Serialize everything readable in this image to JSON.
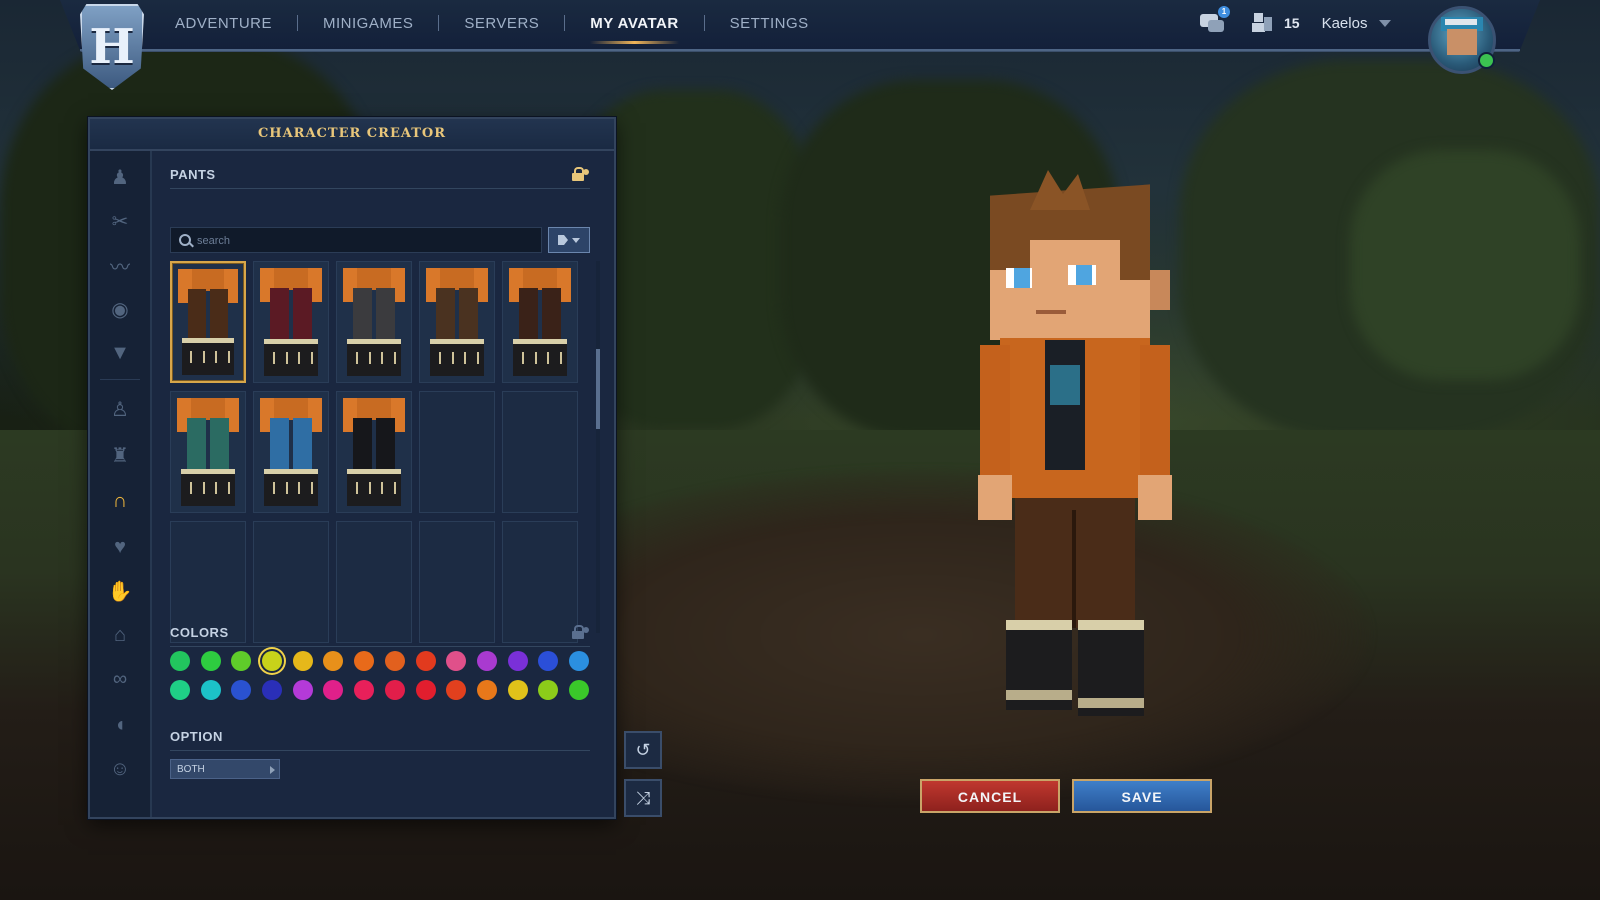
{
  "nav": {
    "items": [
      {
        "label": "ADVENTURE",
        "active": false
      },
      {
        "label": "MINIGAMES",
        "active": false
      },
      {
        "label": "SERVERS",
        "active": false
      },
      {
        "label": "MY AVATAR",
        "active": true
      },
      {
        "label": "SETTINGS",
        "active": false
      }
    ],
    "logo_letter": "H",
    "chat_badge": "1",
    "friends_count": "15",
    "username": "Kaelos"
  },
  "panel": {
    "title": "CHARACTER CREATOR",
    "sidebar_icons": [
      "body-icon",
      "scissors-icon",
      "eyebrows-icon",
      "eye-icon",
      "beard-icon",
      "undershirt-icon",
      "overtop-icon",
      "pants-icon",
      "shoes-icon",
      "gloves-icon",
      "hat-icon",
      "glasses-icon",
      "ear-icon",
      "face-icon"
    ],
    "active_category": "pants-icon",
    "pants": {
      "title": "PANTS",
      "search_placeholder": "search",
      "items": [
        {
          "name": "brown-pants",
          "leg_color": "#4a2c18",
          "selected": true
        },
        {
          "name": "maroon-pants",
          "leg_color": "#5b1a24",
          "selected": false
        },
        {
          "name": "grey-pants",
          "leg_color": "#3b3b3e",
          "selected": false
        },
        {
          "name": "brown-striped-pants",
          "leg_color": "#4a3220",
          "selected": false
        },
        {
          "name": "leather-outfit",
          "leg_color": "#3a2218",
          "selected": false
        },
        {
          "name": "teal-pants",
          "leg_color": "#2b6b62",
          "selected": false
        },
        {
          "name": "blue-jeans",
          "leg_color": "#2f6ea4",
          "selected": false
        },
        {
          "name": "black-pants",
          "leg_color": "#16171b",
          "selected": false
        }
      ],
      "empty_slots": 7
    },
    "colors": {
      "title": "COLORS",
      "row1": [
        "#22c55e",
        "#2ecc40",
        "#5fcc2a",
        "#c8d21a",
        "#e6b81a",
        "#e8901a",
        "#e86a1a",
        "#e2601e",
        "#e23a1e",
        "#e0508a",
        "#a93ad0",
        "#7a30d8",
        "#2b4fd8",
        "#2b8fe0"
      ],
      "row2": [
        "#1fcf86",
        "#1cc2c8",
        "#2a52d0",
        "#2a2fb8",
        "#b43ad8",
        "#e0208a",
        "#e8205a",
        "#e21e4a",
        "#e21e2e",
        "#e2401e",
        "#e8781a",
        "#e0c21a",
        "#8ccc1a",
        "#3ac82a"
      ],
      "selected": "#c8d21a"
    },
    "option": {
      "title": "OPTION",
      "value": "BOTH"
    }
  },
  "actions": {
    "cancel": "CANCEL",
    "save": "SAVE"
  }
}
